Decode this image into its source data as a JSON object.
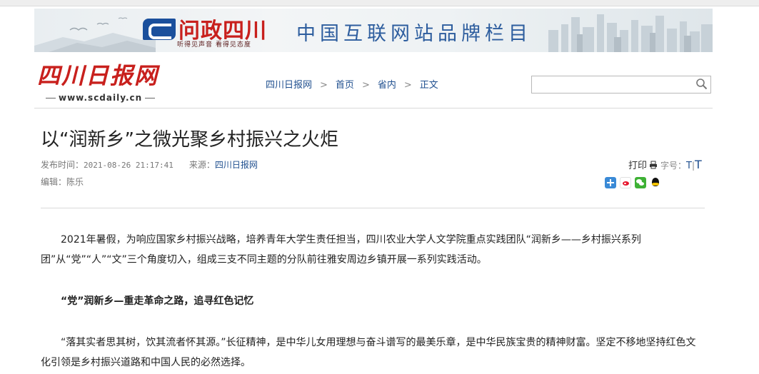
{
  "banner": {
    "title": "问政四川",
    "subtitle": "听得见声音  看得见态度",
    "slogan": "中国互联网站品牌栏目"
  },
  "site": {
    "logo_cn": "四川日报网",
    "logo_url": "www.scdaily.cn"
  },
  "breadcrumb": {
    "items": [
      "四川日报网",
      "首页",
      "省内",
      "正文"
    ],
    "separator": ">"
  },
  "search": {
    "value": "",
    "placeholder": ""
  },
  "article": {
    "title": "以“润新乡”之微光聚乡村振兴之火炬",
    "publish_label": "发布时间：",
    "publish_time": "2021-08-26 21:17:41",
    "source_label": "来源：",
    "source": "四川日报网",
    "editor_label": "编辑：",
    "editor": "陈乐",
    "paragraphs": [
      "2021年暑假，为响应国家乡村振兴战略，培养青年大学生责任担当，四川农业大学人文学院重点实践团队“润新乡——乡村振兴系列团”从“党”“人”“文”三个角度切入，组成三支不同主题的分队前往雅安周边乡镇开展一系列实践活动。",
      "“党”润新乡—重走革命之路，追寻红色记忆",
      "“落其实者思其树，饮其流者怀其源。”长征精神，是中华儿女用理想与奋斗谱写的最美乐章，是中华民族宝贵的精神财富。坚定不移地坚持红色文化引领是乡村振兴道路和中国人民的必然选择。"
    ]
  },
  "tools": {
    "print_label": "打印",
    "font_size_label": "字号：",
    "font_small": "T",
    "font_sep": "|",
    "font_large": "T"
  },
  "share_icons": [
    "share-plus-icon",
    "weibo-icon",
    "wechat-icon",
    "qq-icon"
  ],
  "colors": {
    "brand_red": "#c8201d",
    "link_blue": "#1f4f8f",
    "slogan_blue": "#2d5d9e"
  }
}
